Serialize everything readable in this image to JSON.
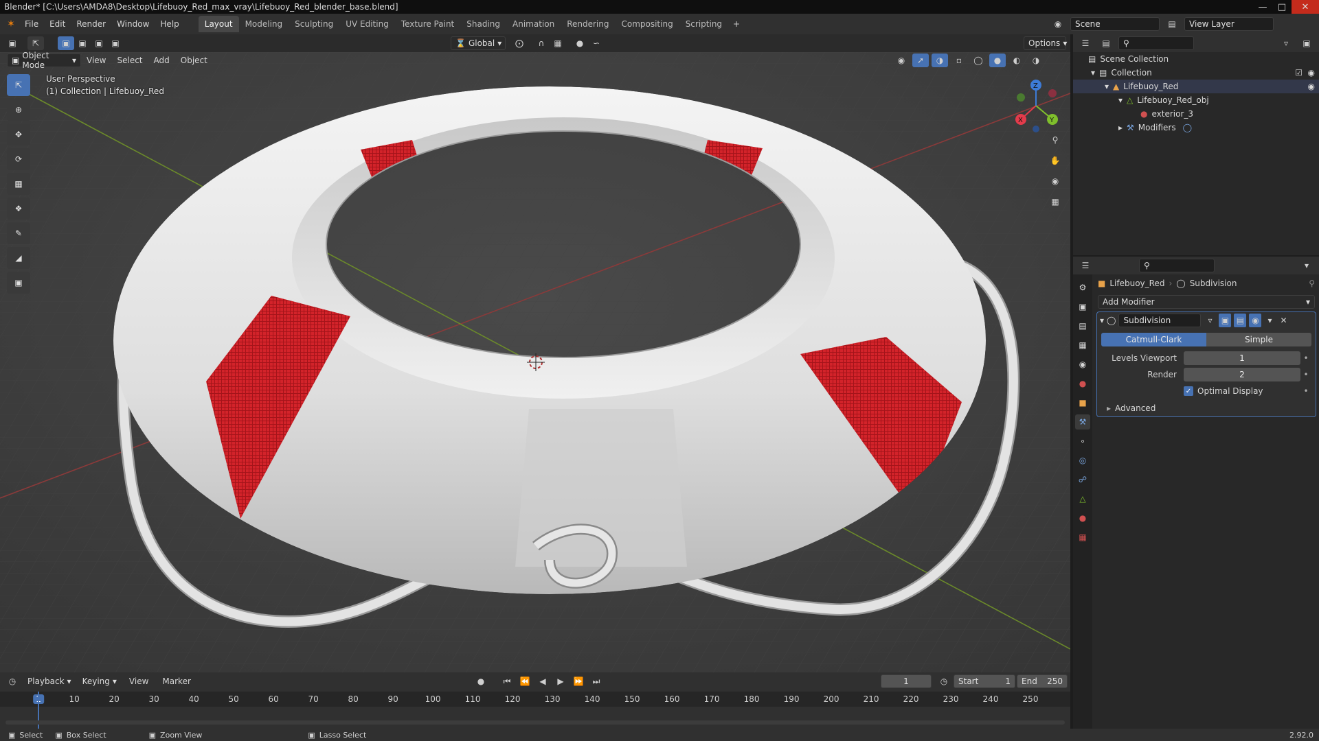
{
  "title": "Blender* [C:\\Users\\AMDA8\\Desktop\\Lifebuoy_Red_max_vray\\Lifebuoy_Red_blender_base.blend]",
  "menu": [
    "File",
    "Edit",
    "Render",
    "Window",
    "Help"
  ],
  "workspaces": [
    "Layout",
    "Modeling",
    "Sculpting",
    "UV Editing",
    "Texture Paint",
    "Shading",
    "Animation",
    "Rendering",
    "Compositing",
    "Scripting"
  ],
  "active_workspace": "Layout",
  "scene_name": "Scene",
  "view_layer": "View Layer",
  "viewport": {
    "mode": "Object Mode",
    "menus": [
      "View",
      "Select",
      "Add",
      "Object"
    ],
    "transform": "Global",
    "options": "Options",
    "perspective_label": "User Perspective",
    "collection_label": "(1) Collection | Lifebuoy_Red"
  },
  "gizmo": {
    "x": "X",
    "y": "Y",
    "z": "Z"
  },
  "outliner": {
    "rows": [
      {
        "label": "Scene Collection",
        "indent": 0
      },
      {
        "label": "Collection",
        "indent": 1
      },
      {
        "label": "Lifebuoy_Red",
        "indent": 2
      },
      {
        "label": "Lifebuoy_Red_obj",
        "indent": 3
      },
      {
        "label": "exterior_3",
        "indent": 4
      },
      {
        "label": "Modifiers",
        "indent": 3
      }
    ]
  },
  "properties": {
    "object": "Lifebuoy_Red",
    "modifier_crumb": "Subdivision",
    "add_modifier": "Add Modifier",
    "modifier_name": "Subdivision",
    "seg_a": "Catmull-Clark",
    "seg_b": "Simple",
    "levels_viewport_label": "Levels Viewport",
    "levels_viewport": "1",
    "render_label": "Render",
    "render": "2",
    "optimal_display": "Optimal Display",
    "advanced": "Advanced"
  },
  "timeline": {
    "menus": [
      "Playback",
      "Keying",
      "View",
      "Marker"
    ],
    "current_frame": "1",
    "start_label": "Start",
    "start": "1",
    "end_label": "End",
    "end": "250",
    "ticks": [
      "1",
      "10",
      "20",
      "30",
      "40",
      "50",
      "60",
      "70",
      "80",
      "90",
      "100",
      "110",
      "120",
      "130",
      "140",
      "150",
      "160",
      "170",
      "180",
      "190",
      "200",
      "210",
      "220",
      "230",
      "240",
      "250"
    ]
  },
  "status": {
    "select": "Select",
    "box_select": "Box Select",
    "zoom_view": "Zoom View",
    "lasso_select": "Lasso Select",
    "version": "2.92.0"
  },
  "colors": {
    "accent": "#4772b3",
    "buoy": "#e9e9e9",
    "band": "#d3232a"
  }
}
